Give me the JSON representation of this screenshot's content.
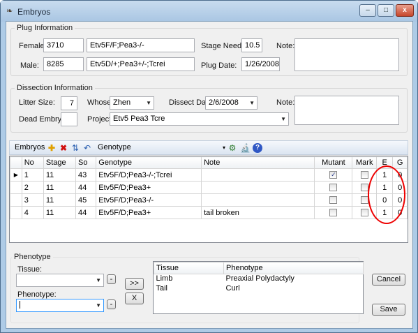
{
  "window": {
    "title": "Embryos",
    "minimize": "–",
    "restore": "□",
    "close": "x"
  },
  "plug": {
    "group_label": "Plug Information",
    "female_label": "Female:",
    "female_id": "3710",
    "female_genotype": "Etv5F/F;Pea3-/-",
    "male_label": "Male:",
    "male_id": "8285",
    "male_genotype": "Etv5D/+;Pea3+/-;Tcrei",
    "stage_needed_label": "Stage Needed:",
    "stage_needed": "10.5",
    "plug_date_label": "Plug Date:",
    "plug_date": "1/26/2008",
    "note_label": "Note:"
  },
  "dissection": {
    "group_label": "Dissection Information",
    "litter_label": "Litter Size:",
    "litter": "7",
    "whose_label": "Whose:",
    "whose": "Zhen",
    "dissect_date_label": "Dissect Date:",
    "dissect_date": "2/6/2008",
    "note_label": "Note:",
    "dead_label": "Dead Embryos:",
    "project_label": "Project:",
    "project": "Etv5 Pea3 Tcre"
  },
  "toolbar": {
    "label": "Embryos",
    "genotype_label": "Genotype"
  },
  "grid": {
    "columns": [
      "No",
      "Stage",
      "So",
      "Genotype",
      "Note",
      "Mutant",
      "Mark",
      "E",
      "G"
    ],
    "rows": [
      {
        "no": "1",
        "stage": "11",
        "so": "43",
        "genotype": "Etv5F/D;Pea3-/-;Tcrei",
        "note": "",
        "mutant": true,
        "mark": false,
        "e": "1",
        "g": "0"
      },
      {
        "no": "2",
        "stage": "11",
        "so": "44",
        "genotype": "Etv5F/D;Pea3+",
        "note": "",
        "mutant": false,
        "mark": false,
        "e": "1",
        "g": "0"
      },
      {
        "no": "3",
        "stage": "11",
        "so": "45",
        "genotype": "Etv5F/D;Pea3-/-",
        "note": "",
        "mutant": false,
        "mark": false,
        "e": "0",
        "g": "0"
      },
      {
        "no": "4",
        "stage": "11",
        "so": "44",
        "genotype": "Etv5F/D;Pea3+",
        "note": "tail broken",
        "mutant": false,
        "mark": false,
        "e": "1",
        "g": "0"
      }
    ]
  },
  "phenotype": {
    "group_label": "Phenotype",
    "tissue_label": "Tissue:",
    "phenotype_label": "Phenotype:",
    "minus": "-",
    "add": ">>",
    "remove": "X",
    "columns": [
      "Tissue",
      "Phenotype"
    ],
    "rows": [
      {
        "tissue": "Limb",
        "phenotype": "Preaxial Polydactyly"
      },
      {
        "tissue": "Tail",
        "phenotype": "Curl"
      }
    ]
  },
  "buttons": {
    "cancel": "Cancel",
    "save": "Save"
  }
}
